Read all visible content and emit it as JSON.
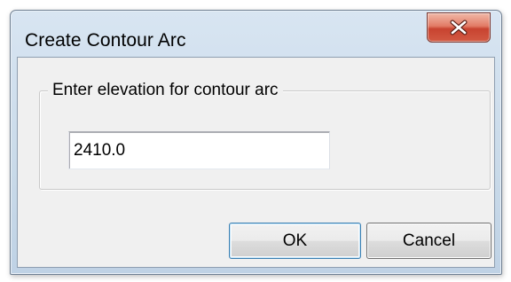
{
  "window": {
    "title": "Create Contour Arc",
    "close_icon": "close-icon"
  },
  "group": {
    "label": "Enter elevation for contour arc"
  },
  "elevation_input": {
    "value": "2410.0"
  },
  "buttons": {
    "ok_label": "OK",
    "cancel_label": "Cancel"
  },
  "colors": {
    "close_button": "#d25a43",
    "dialog_background": "#f0f0f0",
    "title_bar": "#c9dae9"
  }
}
